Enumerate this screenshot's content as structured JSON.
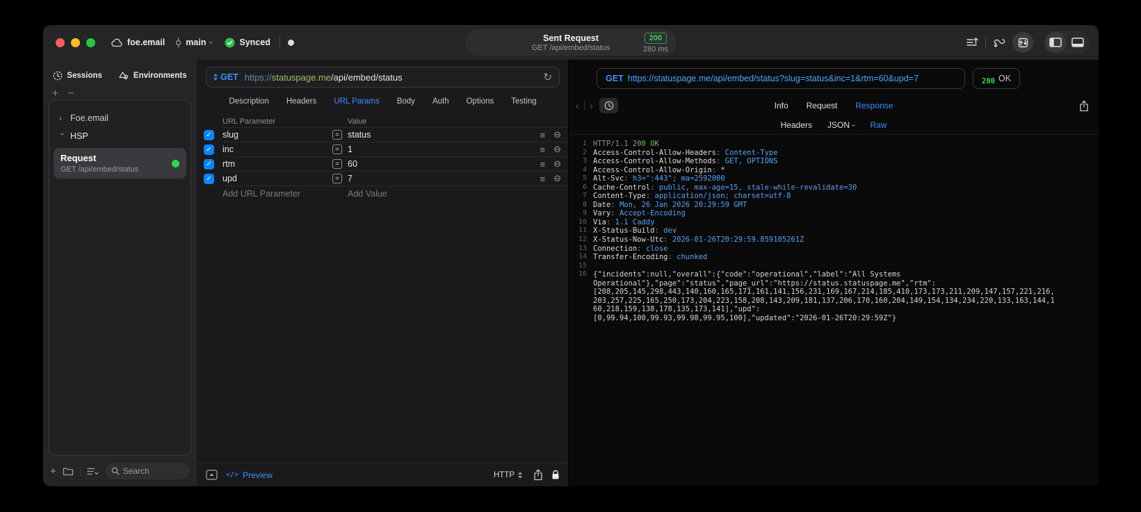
{
  "colors": {
    "accent_blue": "#3f8cff",
    "link_blue": "#4da3ff",
    "status_green": "#32d74b",
    "value_blue": "#58a0f0",
    "code_green": "#6fba5c",
    "checkbox_blue": "#0a84ff",
    "host_green": "#9cbf6b"
  },
  "icons": {
    "plus": "+",
    "minus": "−",
    "chevron": "›",
    "back_chevron": "‹",
    "forward_chevron": "›",
    "check": "✓",
    "equals": "=",
    "lines": "≡",
    "remove": "⊖",
    "refresh": "↻",
    "code": "</>"
  },
  "titlebar": {
    "project": "foe.email",
    "branch": "main",
    "sync_label": "Synced",
    "request_pill": {
      "title": "Sent Request",
      "subtitle": "GET /api/embed/status",
      "status_code": "200",
      "duration": "280 ms"
    }
  },
  "sidebar": {
    "tabs": [
      {
        "label": "Sessions"
      },
      {
        "label": "Environments"
      }
    ],
    "tree": [
      {
        "label": "Foe.email"
      },
      {
        "label": "HSP"
      }
    ],
    "request": {
      "name": "Request",
      "subtitle": "GET /api/embed/status"
    },
    "search_placeholder": "Search"
  },
  "request_pane": {
    "method": "GET",
    "url_scheme": "https://",
    "url_host": "statuspage.me",
    "url_path": "/api/embed/status",
    "tabs": [
      "Description",
      "Headers",
      "URL Params",
      "Body",
      "Auth",
      "Options",
      "Testing"
    ],
    "active_tab": "URL Params",
    "table": {
      "columns": [
        "URL Parameter",
        "Value"
      ],
      "rows": [
        {
          "enabled": true,
          "name": "slug",
          "value": "status"
        },
        {
          "enabled": true,
          "name": "inc",
          "value": "1"
        },
        {
          "enabled": true,
          "name": "rtm",
          "value": "60"
        },
        {
          "enabled": true,
          "name": "upd",
          "value": "7"
        }
      ],
      "add_row": {
        "name": "Add URL Parameter",
        "value": "Add Value"
      }
    },
    "bottom": {
      "preview_label": "Preview",
      "protocol": "HTTP"
    }
  },
  "response_pane": {
    "request": {
      "method": "GET",
      "url": "https://statuspage.me/api/embed/status?slug=status&inc=1&rtm=60&upd=7"
    },
    "status": {
      "code": "200",
      "text": "OK"
    },
    "tabs": [
      "Info",
      "Request",
      "Response"
    ],
    "active_tab": "Response",
    "view_tabs": [
      {
        "label": "Headers"
      },
      {
        "label": "JSON",
        "dropdown": true
      },
      {
        "label": "Raw"
      }
    ],
    "active_view": "Raw",
    "lines": [
      {
        "num": "1",
        "segs": [
          [
            "g",
            "HTTP/1.1 "
          ],
          [
            "gr",
            "200 OK"
          ]
        ]
      },
      {
        "num": "2",
        "segs": [
          [
            "k",
            "Access-Control-Allow-Headers"
          ],
          [
            "g",
            ": "
          ],
          [
            "v",
            "Content-Type"
          ]
        ]
      },
      {
        "num": "3",
        "segs": [
          [
            "k",
            "Access-Control-Allow-Methods"
          ],
          [
            "g",
            ": "
          ],
          [
            "v",
            "GET, OPTIONS"
          ]
        ]
      },
      {
        "num": "4",
        "segs": [
          [
            "k",
            "Access-Control-Allow-Origin"
          ],
          [
            "g",
            ": "
          ],
          [
            "w",
            "*"
          ]
        ]
      },
      {
        "num": "5",
        "segs": [
          [
            "k",
            "Alt-Svc"
          ],
          [
            "g",
            ": "
          ],
          [
            "v",
            "h3=\":443\"; ma=2592000"
          ]
        ]
      },
      {
        "num": "6",
        "segs": [
          [
            "k",
            "Cache-Control"
          ],
          [
            "g",
            ": "
          ],
          [
            "v",
            "public, max-age=15, stale-while-revalidate=30"
          ]
        ]
      },
      {
        "num": "7",
        "segs": [
          [
            "k",
            "Content-Type"
          ],
          [
            "g",
            ": "
          ],
          [
            "v",
            "application/json; charset=utf-8"
          ]
        ]
      },
      {
        "num": "8",
        "segs": [
          [
            "k",
            "Date"
          ],
          [
            "g",
            ": "
          ],
          [
            "v",
            "Mon, 26 Jan 2026 20:29:59 GMT"
          ]
        ]
      },
      {
        "num": "9",
        "segs": [
          [
            "k",
            "Vary"
          ],
          [
            "g",
            ": "
          ],
          [
            "v",
            "Accept-Encoding"
          ]
        ]
      },
      {
        "num": "10",
        "segs": [
          [
            "k",
            "Via"
          ],
          [
            "g",
            ": "
          ],
          [
            "v",
            "1.1 Caddy"
          ]
        ]
      },
      {
        "num": "11",
        "segs": [
          [
            "k",
            "X-Status-Build"
          ],
          [
            "g",
            ": "
          ],
          [
            "v",
            "dev"
          ]
        ]
      },
      {
        "num": "12",
        "segs": [
          [
            "k",
            "X-Status-Now-Utc"
          ],
          [
            "g",
            ": "
          ],
          [
            "v",
            "2026-01-26T20:29:59.859105261Z"
          ]
        ]
      },
      {
        "num": "13",
        "segs": [
          [
            "k",
            "Connection"
          ],
          [
            "g",
            ": "
          ],
          [
            "v",
            "close"
          ]
        ]
      },
      {
        "num": "14",
        "segs": [
          [
            "k",
            "Transfer-Encoding"
          ],
          [
            "g",
            ": "
          ],
          [
            "v",
            "chunked"
          ]
        ]
      },
      {
        "num": "15",
        "segs": []
      },
      {
        "num": "16",
        "segs": [
          [
            "w",
            "{\"incidents\":null,\"overall\":{\"code\":\"operational\",\"label\":\"All Systems"
          ]
        ]
      },
      {
        "num": "",
        "segs": [
          [
            "w",
            "Operational\"},\"page\":\"status\",\"page_url\":\"https://status.statuspage.me\",\"rtm\":"
          ]
        ]
      },
      {
        "num": "",
        "segs": [
          [
            "w",
            "[208,205,145,298,443,140,160,165,171,161,141,156,231,169,167,214,185,410,173,173,211,209,147,157,221,216,"
          ]
        ]
      },
      {
        "num": "",
        "segs": [
          [
            "w",
            "203,257,225,165,250,173,204,223,158,208,143,209,181,137,206,170,160,204,149,154,134,234,220,133,163,144,1"
          ]
        ]
      },
      {
        "num": "",
        "segs": [
          [
            "w",
            "60,218,159,138,178,135,173,141],\"upd\":"
          ]
        ]
      },
      {
        "num": "",
        "segs": [
          [
            "w",
            "[0,99.94,100,99.93,99.98,99.95,100],\"updated\":\"2026-01-26T20:29:59Z\"}"
          ]
        ]
      }
    ]
  }
}
